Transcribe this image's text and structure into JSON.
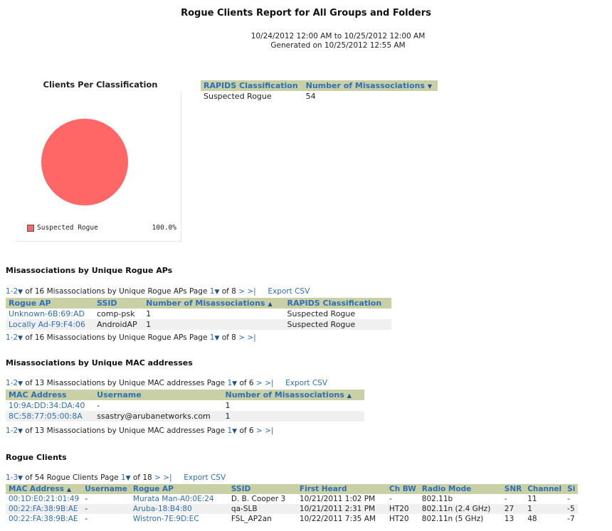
{
  "report": {
    "title": "Rogue Clients Report for All Groups and Folders",
    "date_range": "10/24/2012 12:00 AM to 10/25/2012 12:00 AM",
    "generated": "Generated on 10/25/2012 12:55 AM"
  },
  "chart_data": {
    "type": "pie",
    "title": "Clients Per Classification",
    "categories": [
      "Suspected Rogue"
    ],
    "values": [
      100.0
    ],
    "colors": [
      "#ff6666"
    ],
    "legend_label": "Suspected Rogue",
    "legend_pct": "100.0%"
  },
  "classification_table": {
    "headers": [
      "RAPIDS Classification",
      "Number of Misassociations"
    ],
    "rows": [
      [
        "Suspected Rogue",
        "54"
      ]
    ]
  },
  "misassoc_aps": {
    "title": "Misassociations by Unique Rogue APs",
    "pager": {
      "range": "1-2",
      "text": "of 16 Misassociations by Unique Rogue APs",
      "page_label": "Page",
      "page": "1",
      "of_pages": "of 8",
      "next": ">",
      "last": ">|",
      "export": "Export CSV"
    },
    "headers": [
      "Rogue AP",
      "SSID",
      "Number of Misassociations",
      "RAPIDS Classification"
    ],
    "rows": [
      [
        "Unknown-6B:69:AD",
        "comp-psk",
        "1",
        "Suspected Rogue"
      ],
      [
        "Locally Ad-F9:F4:06",
        "AndroidAP",
        "1",
        "Suspected Rogue"
      ]
    ]
  },
  "misassoc_macs": {
    "title": "Misassociations by Unique MAC addresses",
    "pager": {
      "range": "1-2",
      "text": "of 13 Misassociations by Unique MAC addresses",
      "page_label": "Page",
      "page": "1",
      "of_pages": "of 6",
      "next": ">",
      "last": ">|",
      "export": "Export CSV"
    },
    "headers": [
      "MAC Address",
      "Username",
      "Number of Misassociations"
    ],
    "rows": [
      [
        "10:9A:DD:34:DA:40",
        "-",
        "1"
      ],
      [
        "8C:58:77:05:00:8A",
        "ssastry@arubanetworks.com",
        "1"
      ]
    ]
  },
  "rogue_clients": {
    "title": "Rogue Clients",
    "pager": {
      "range": "1-3",
      "text": "of 54 Rogue Clients",
      "page_label": "Page",
      "page": "1",
      "of_pages": "of 18",
      "next": ">",
      "last": ">|",
      "export": "Export CSV"
    },
    "headers": [
      "MAC Address",
      "Username",
      "Rogue AP",
      "SSID",
      "First Heard",
      "Ch BW",
      "Radio Mode",
      "SNR",
      "Channel",
      "Si"
    ],
    "rows": [
      [
        "00:1D:E0:21:01:49",
        "-",
        "Murata Man-A0:0E:24",
        "D. B. Cooper 3",
        "10/21/2011 1:02 PM",
        "-",
        "802.11b",
        "-",
        "11",
        "-"
      ],
      [
        "00:22:FA:38:9B:AE",
        "-",
        "Aruba-18:B4:80",
        "qa-SLB",
        "10/21/2011 2:31 PM",
        "HT20",
        "802.11n (2.4 GHz)",
        "27",
        "1",
        "-5"
      ],
      [
        "00:22:FA:38:9B:AE",
        "-",
        "Wistron-7E:9D:EC",
        "FSL_AP2an",
        "10/22/2011 7:35 AM",
        "HT20",
        "802.11n (5 GHz)",
        "13",
        "48",
        "-7"
      ]
    ]
  }
}
